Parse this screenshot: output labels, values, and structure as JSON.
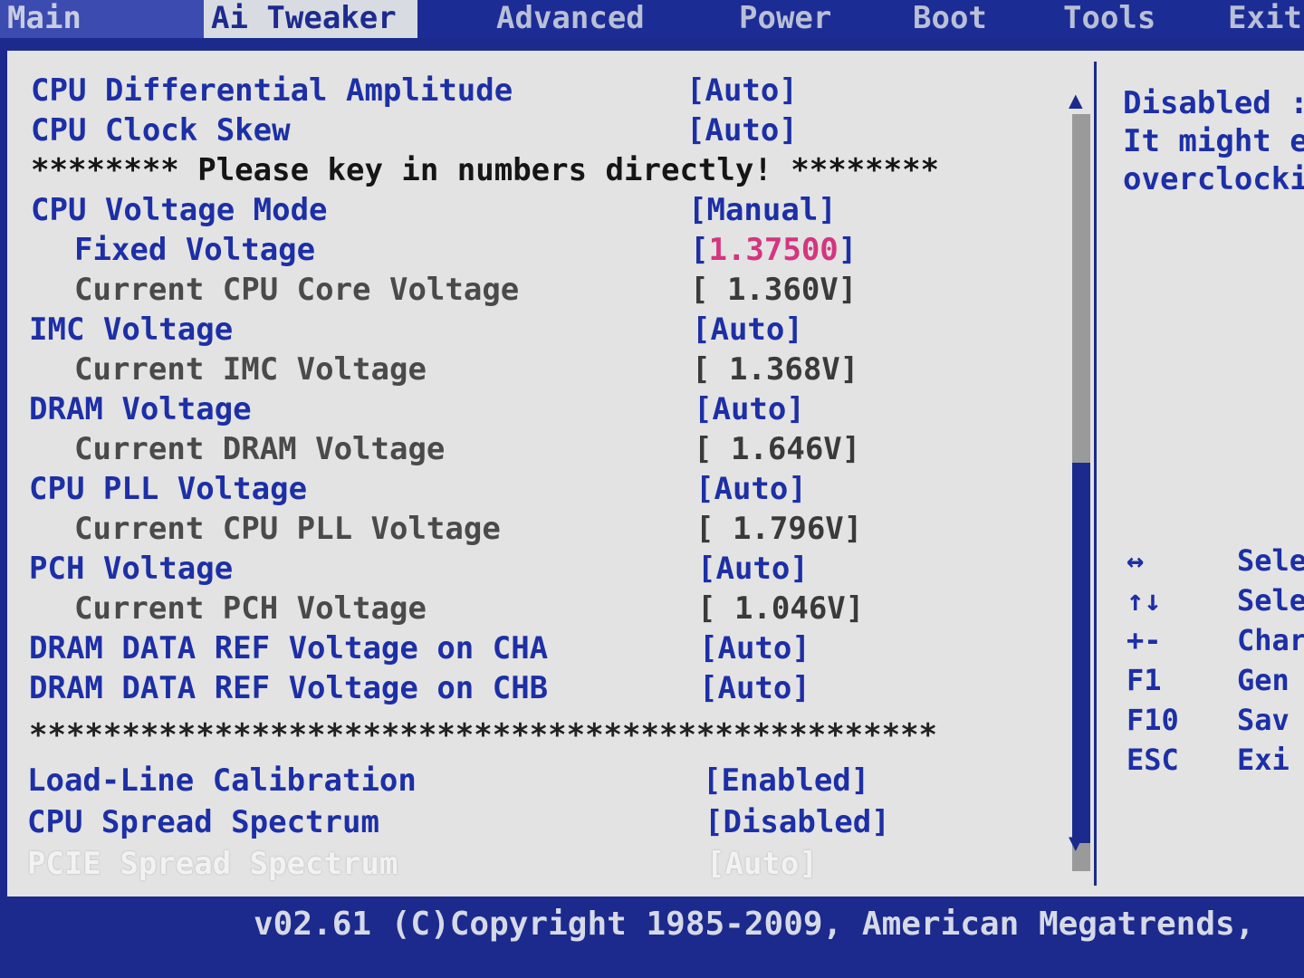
{
  "tabs": [
    {
      "label": "Main"
    },
    {
      "label": "Ai Tweaker"
    },
    {
      "label": "Advanced"
    },
    {
      "label": "Power"
    },
    {
      "label": "Boot"
    },
    {
      "label": "Tools"
    },
    {
      "label": "Exit"
    }
  ],
  "settings": [
    {
      "label": "CPU Differential Amplitude",
      "value": "[Auto]"
    },
    {
      "label": "CPU Clock Skew",
      "value": "[Auto]"
    },
    {
      "note": "******** Please key in numbers directly! ********"
    },
    {
      "label": "CPU Voltage Mode",
      "value": "[Manual]"
    },
    {
      "label": "Fixed Voltage",
      "value_open": "[",
      "value_inner": "1.37500",
      "value_close": "]"
    },
    {
      "label": "Current CPU Core Voltage",
      "value": "[ 1.360V]"
    },
    {
      "label": "IMC Voltage",
      "value": "[Auto]"
    },
    {
      "label": "Current IMC Voltage",
      "value": "[ 1.368V]"
    },
    {
      "label": "DRAM Voltage",
      "value": "[Auto]"
    },
    {
      "label": "Current DRAM Voltage",
      "value": "[ 1.646V]"
    },
    {
      "label": "CPU PLL Voltage",
      "value": "[Auto]"
    },
    {
      "label": "Current CPU PLL Voltage",
      "value": "[ 1.796V]"
    },
    {
      "label": "PCH Voltage",
      "value": "[Auto]"
    },
    {
      "label": "Current PCH Voltage",
      "value": "[ 1.046V]"
    },
    {
      "label": "DRAM DATA REF Voltage on CHA",
      "value": "[Auto]"
    },
    {
      "label": "DRAM DATA REF Voltage on CHB",
      "value": "[Auto]"
    },
    {
      "stars": "*************************************************"
    },
    {
      "label": "Load-Line Calibration",
      "value": "[Enabled]"
    },
    {
      "label": "CPU Spread Spectrum",
      "value": "[Disabled]"
    },
    {
      "label": "PCIE Spread Spectrum",
      "value": "[Auto]"
    }
  ],
  "help": {
    "lines": [
      "Disabled :",
      "It might e",
      "overclocki"
    ]
  },
  "keys": [
    {
      "key": "↔",
      "desc": "Sele"
    },
    {
      "key": "↑↓",
      "desc": "Sele"
    },
    {
      "key": "+-",
      "desc": "Char"
    },
    {
      "key": "F1",
      "desc": "Gen"
    },
    {
      "key": "F10",
      "desc": "Sav"
    },
    {
      "key": "ESC",
      "desc": "Exi"
    }
  ],
  "footer": {
    "text": "v02.61 (C)Copyright 1985-2009, American Megatrends,"
  },
  "colors": {
    "bios_blue": "#1b2a8c",
    "panel_gray": "#e3e3e3",
    "label_blue": "#1d2fa6",
    "value_pink": "#d4357f"
  }
}
